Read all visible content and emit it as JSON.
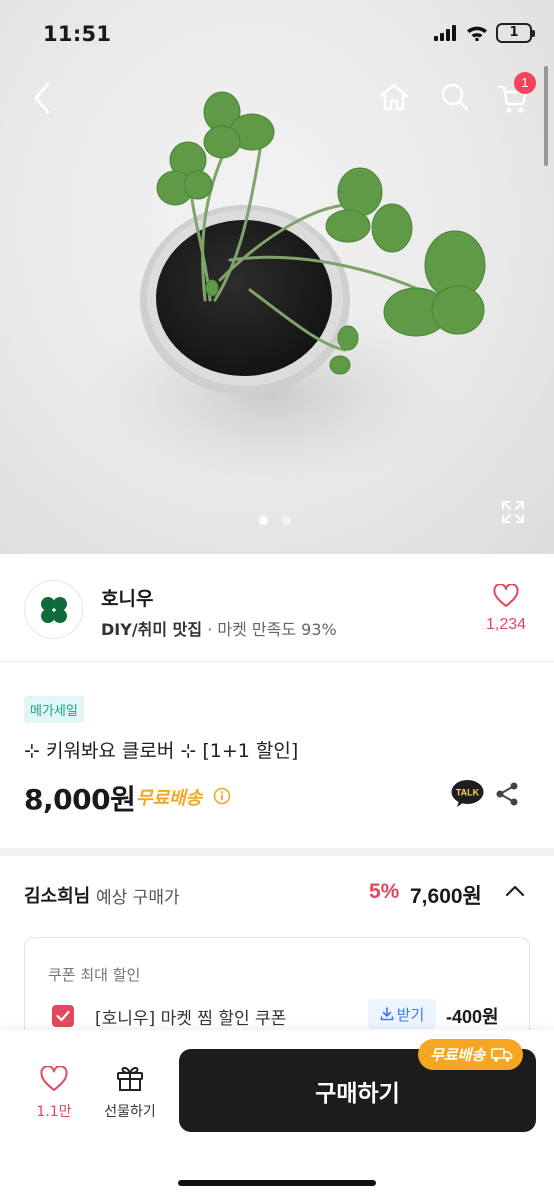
{
  "status_bar": {
    "time": "11:51",
    "battery": "1"
  },
  "header": {
    "back_icon": "chevron-left-icon",
    "home_icon": "home-icon",
    "search_icon": "search-icon",
    "cart_icon": "cart-icon",
    "cart_badge": "1"
  },
  "gallery": {
    "image_count": 2,
    "current_index": 1,
    "expand_icon": "expand-icon"
  },
  "seller": {
    "name": "호니우",
    "category": "DIY/취미 맛집",
    "satisfaction": " · 마켓 만족도 93%",
    "favorite_count": "1,234"
  },
  "product": {
    "tag": "메가세일",
    "title": "⊹ 키워봐요 클로버 ⊹ [1+1 할인]",
    "price": "8,000원",
    "free_shipping": "무료배송"
  },
  "expected_price": {
    "user": "김소희님",
    "label": "예상 구매가",
    "discount_rate": "5%",
    "price": "7,600원"
  },
  "coupon": {
    "title": "쿠폰 최대 할인",
    "name": "[호니우] 마켓 찜 할인 쿠폰",
    "download_label": "받기",
    "amount": "-400원",
    "checked": true
  },
  "bottom_bar": {
    "like_count": "1.1만",
    "gift_label": "선물하기",
    "buy_label": "구매하기",
    "shipping_badge": "무료배송"
  },
  "colors": {
    "accent_red": "#e0495e",
    "mint_tag": "#16a38e",
    "orange": "#f5a623",
    "buy_button": "#1c1c1c"
  }
}
